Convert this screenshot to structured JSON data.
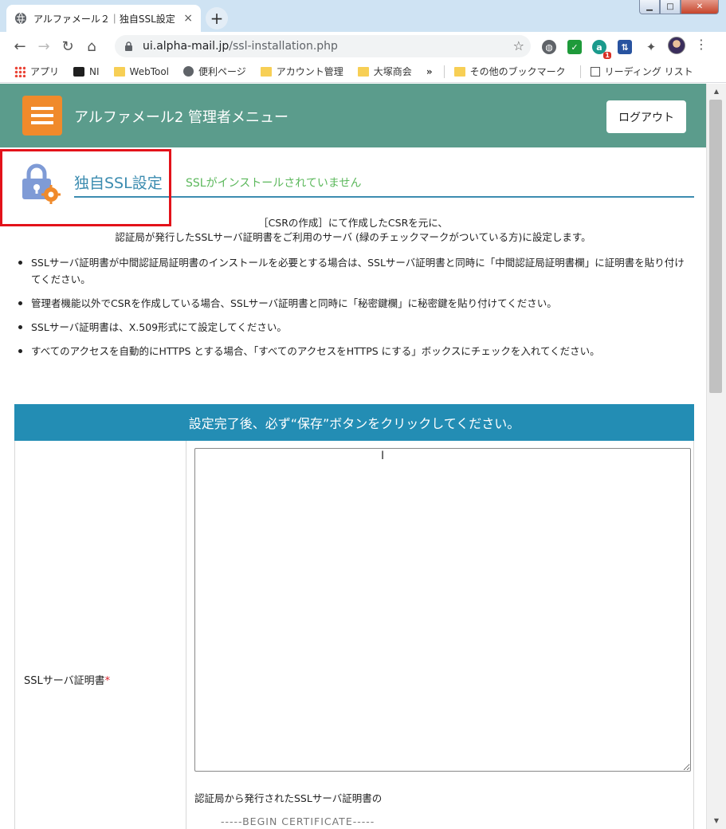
{
  "browser": {
    "tab_title": "アルファメール２｜独自SSL設定",
    "tab_close": "×",
    "new_tab": "+",
    "url_host": "ui.alpha-mail.jp",
    "url_path": "/ssl-installation.php",
    "ext_badge": "1",
    "ext_a_letter": "a",
    "bookmarks": [
      {
        "label": "アプリ"
      },
      {
        "label": "NI"
      },
      {
        "label": "WebTool"
      },
      {
        "label": "便利ページ"
      },
      {
        "label": "アカウント管理"
      },
      {
        "label": "大塚商会"
      },
      {
        "label": "»"
      },
      {
        "label": "その他のブックマーク"
      },
      {
        "label": "リーディング リスト"
      }
    ]
  },
  "header": {
    "app_title": "アルファメール2 管理者メニュー",
    "logout_label": "ログアウト",
    "brand_color": "#5b9c8c",
    "logo_color": "#f08a2b"
  },
  "section": {
    "title": "独自SSL設定",
    "status": "SSLがインストールされていません",
    "title_color": "#3c8cb0",
    "status_color": "#5cb85c"
  },
  "intro": {
    "line1": "［CSRの作成］にて作成したCSRを元に、",
    "line2": "認証局が発行したSSLサーバ証明書をご利用のサーバ (緑のチェックマークがついている方)に設定します。"
  },
  "notes": [
    "SSLサーバ証明書が中間認証局証明書のインストールを必要とする場合は、SSLサーバ証明書と同時に「中間認証局証明書欄」に証明書を貼り付けてください。",
    "管理者機能以外でCSRを作成している場合、SSLサーバ証明書と同時に「秘密鍵欄」に秘密鍵を貼り付けてください。",
    "SSLサーバ証明書は、X.509形式にて設定してください。",
    "すべてのアクセスを自動的にHTTPS とする場合、「すべてのアクセスをHTTPS にする」ボックスにチェックを入れてください。"
  ],
  "form": {
    "banner": "設定完了後、必ず“保存”ボタンをクリックしてください。",
    "banner_color": "#238db4",
    "cert_label": "SSLサーバ証明書",
    "required_mark": "*",
    "cert_value": "",
    "help_text": "認証局から発行されたSSLサーバ証明書の",
    "help_text_2": "-----BEGIN CERTIFICATE-----"
  }
}
